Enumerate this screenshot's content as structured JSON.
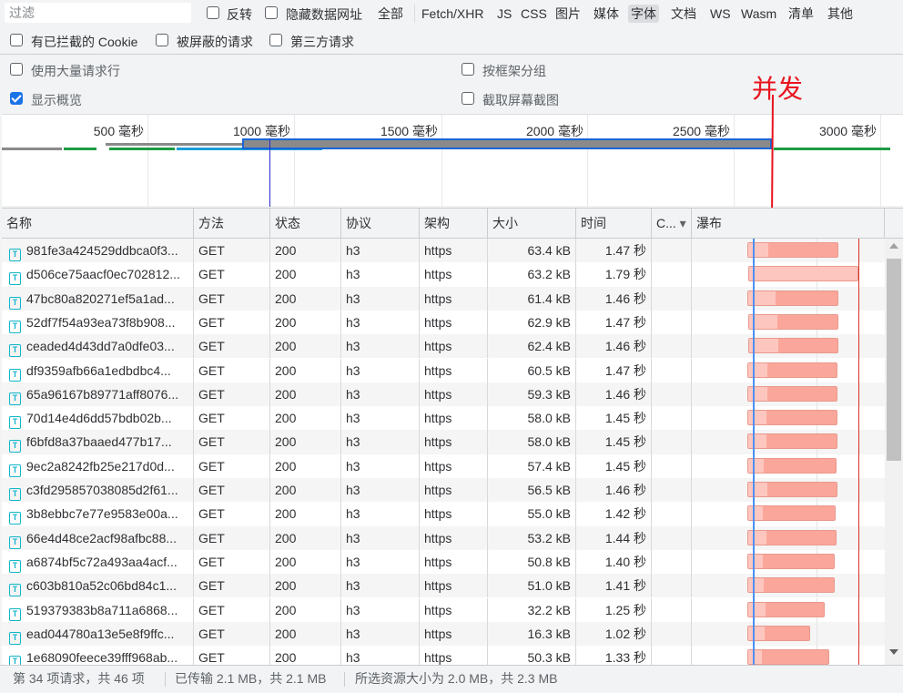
{
  "filter": {
    "placeholder": "过滤",
    "invert": "反转",
    "hide_data_urls": "隐藏数据网址"
  },
  "types": [
    {
      "label": "全部"
    },
    {
      "label": "Fetch/XHR"
    },
    {
      "label": "JS"
    },
    {
      "label": "CSS"
    },
    {
      "label": "图片"
    },
    {
      "label": "媒体"
    },
    {
      "label": "字体",
      "active": true
    },
    {
      "label": "文档"
    },
    {
      "label": "WS"
    },
    {
      "label": "Wasm"
    },
    {
      "label": "清单"
    },
    {
      "label": "其他"
    }
  ],
  "filters2": {
    "blocked_cookies": "有已拦截的 Cookie",
    "blocked_requests": "被屏蔽的请求",
    "third_party": "第三方请求"
  },
  "settings": {
    "big_rows": "使用大量请求行",
    "show_overview": "显示概览",
    "show_overview_checked": true,
    "group_by_frame": "按框架分组",
    "screenshots": "截取屏幕截图"
  },
  "annotation": "并发",
  "overview_ticks": [
    "500 毫秒",
    "1000 毫秒",
    "1500 毫秒",
    "2000 毫秒",
    "2500 毫秒",
    "3000 毫秒"
  ],
  "columns": [
    "名称",
    "方法",
    "状态",
    "协议",
    "架构",
    "大小",
    "时间",
    "C...",
    "瀑布"
  ],
  "rows": [
    [
      "981fe3a424529ddbca0f3...",
      "GET",
      "200",
      "h3",
      "https",
      "63.4 kB",
      "1.47 秒"
    ],
    [
      "d506ce75aacf0ec702812...",
      "GET",
      "200",
      "h3",
      "https",
      "63.2 kB",
      "1.79 秒"
    ],
    [
      "47bc80a820271ef5a1ad...",
      "GET",
      "200",
      "h3",
      "https",
      "61.4 kB",
      "1.46 秒"
    ],
    [
      "52df7f54a93ea73f8b908...",
      "GET",
      "200",
      "h3",
      "https",
      "62.9 kB",
      "1.47 秒"
    ],
    [
      "ceaded4d43dd7a0dfe03...",
      "GET",
      "200",
      "h3",
      "https",
      "62.4 kB",
      "1.46 秒"
    ],
    [
      "df9359afb66a1edbdbc4...",
      "GET",
      "200",
      "h3",
      "https",
      "60.5 kB",
      "1.47 秒"
    ],
    [
      "65a96167b89771aff8076...",
      "GET",
      "200",
      "h3",
      "https",
      "59.3 kB",
      "1.46 秒"
    ],
    [
      "70d14e4d6dd57bdb02b...",
      "GET",
      "200",
      "h3",
      "https",
      "58.0 kB",
      "1.45 秒"
    ],
    [
      "f6bfd8a37baaed477b17...",
      "GET",
      "200",
      "h3",
      "https",
      "58.0 kB",
      "1.45 秒"
    ],
    [
      "9ec2a8242fb25e217d0d...",
      "GET",
      "200",
      "h3",
      "https",
      "57.4 kB",
      "1.45 秒"
    ],
    [
      "c3fd295857038085d2f61...",
      "GET",
      "200",
      "h3",
      "https",
      "56.5 kB",
      "1.46 秒"
    ],
    [
      "3b8ebbc7e77e9583e00a...",
      "GET",
      "200",
      "h3",
      "https",
      "55.0 kB",
      "1.42 秒"
    ],
    [
      "66e4d48ce2acf98afbc88...",
      "GET",
      "200",
      "h3",
      "https",
      "53.2 kB",
      "1.44 秒"
    ],
    [
      "a6874bf5c72a493aa4acf...",
      "GET",
      "200",
      "h3",
      "https",
      "50.8 kB",
      "1.40 秒"
    ],
    [
      "c603b810a52c06bd84c1...",
      "GET",
      "200",
      "h3",
      "https",
      "51.0 kB",
      "1.41 秒"
    ],
    [
      "519379383b8a711a6868...",
      "GET",
      "200",
      "h3",
      "https",
      "32.2 kB",
      "1.25 秒"
    ],
    [
      "ead044780a13e5e8f9ffc...",
      "GET",
      "200",
      "h3",
      "https",
      "16.3 kB",
      "1.02 秒"
    ],
    [
      "1e68090feece39fff968ab...",
      "GET",
      "200",
      "h3",
      "https",
      "50.3 kB",
      "1.33 秒"
    ]
  ],
  "status": {
    "requests": "第 34 项请求，共 46 项",
    "transferred": "已传输 2.1 MB，共 2.1 MB",
    "resources": "所选资源大小为 2.0 MB，共 2.3 MB"
  }
}
